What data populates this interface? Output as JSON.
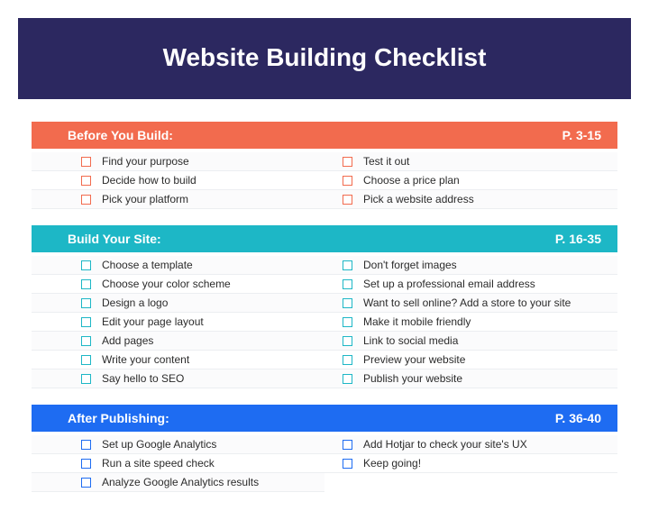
{
  "title": "Website Building Checklist",
  "sections": [
    {
      "title": "Before You Build:",
      "page": "P. 3-15",
      "color": "orange",
      "left": [
        "Find your purpose",
        "Decide how to build",
        "Pick your platform"
      ],
      "right": [
        "Test it out",
        "Choose a price plan",
        "Pick a website address"
      ]
    },
    {
      "title": "Build Your Site:",
      "page": "P. 16-35",
      "color": "teal",
      "left": [
        "Choose a template",
        "Choose your color scheme",
        "Design a logo",
        "Edit your page layout",
        "Add pages",
        "Write your content",
        "Say hello to SEO"
      ],
      "right": [
        "Don't forget images",
        "Set up a professional email address",
        "Want to sell online? Add a store to your site",
        "Make it mobile friendly",
        "Link to social media",
        "Preview your website",
        "Publish your website"
      ]
    },
    {
      "title": "After Publishing:",
      "page": "P. 36-40",
      "color": "blue",
      "left": [
        "Set up Google Analytics",
        "Run a site speed check",
        "Analyze Google Analytics results"
      ],
      "right": [
        "Add Hotjar to check your site's UX",
        "Keep going!"
      ]
    }
  ]
}
